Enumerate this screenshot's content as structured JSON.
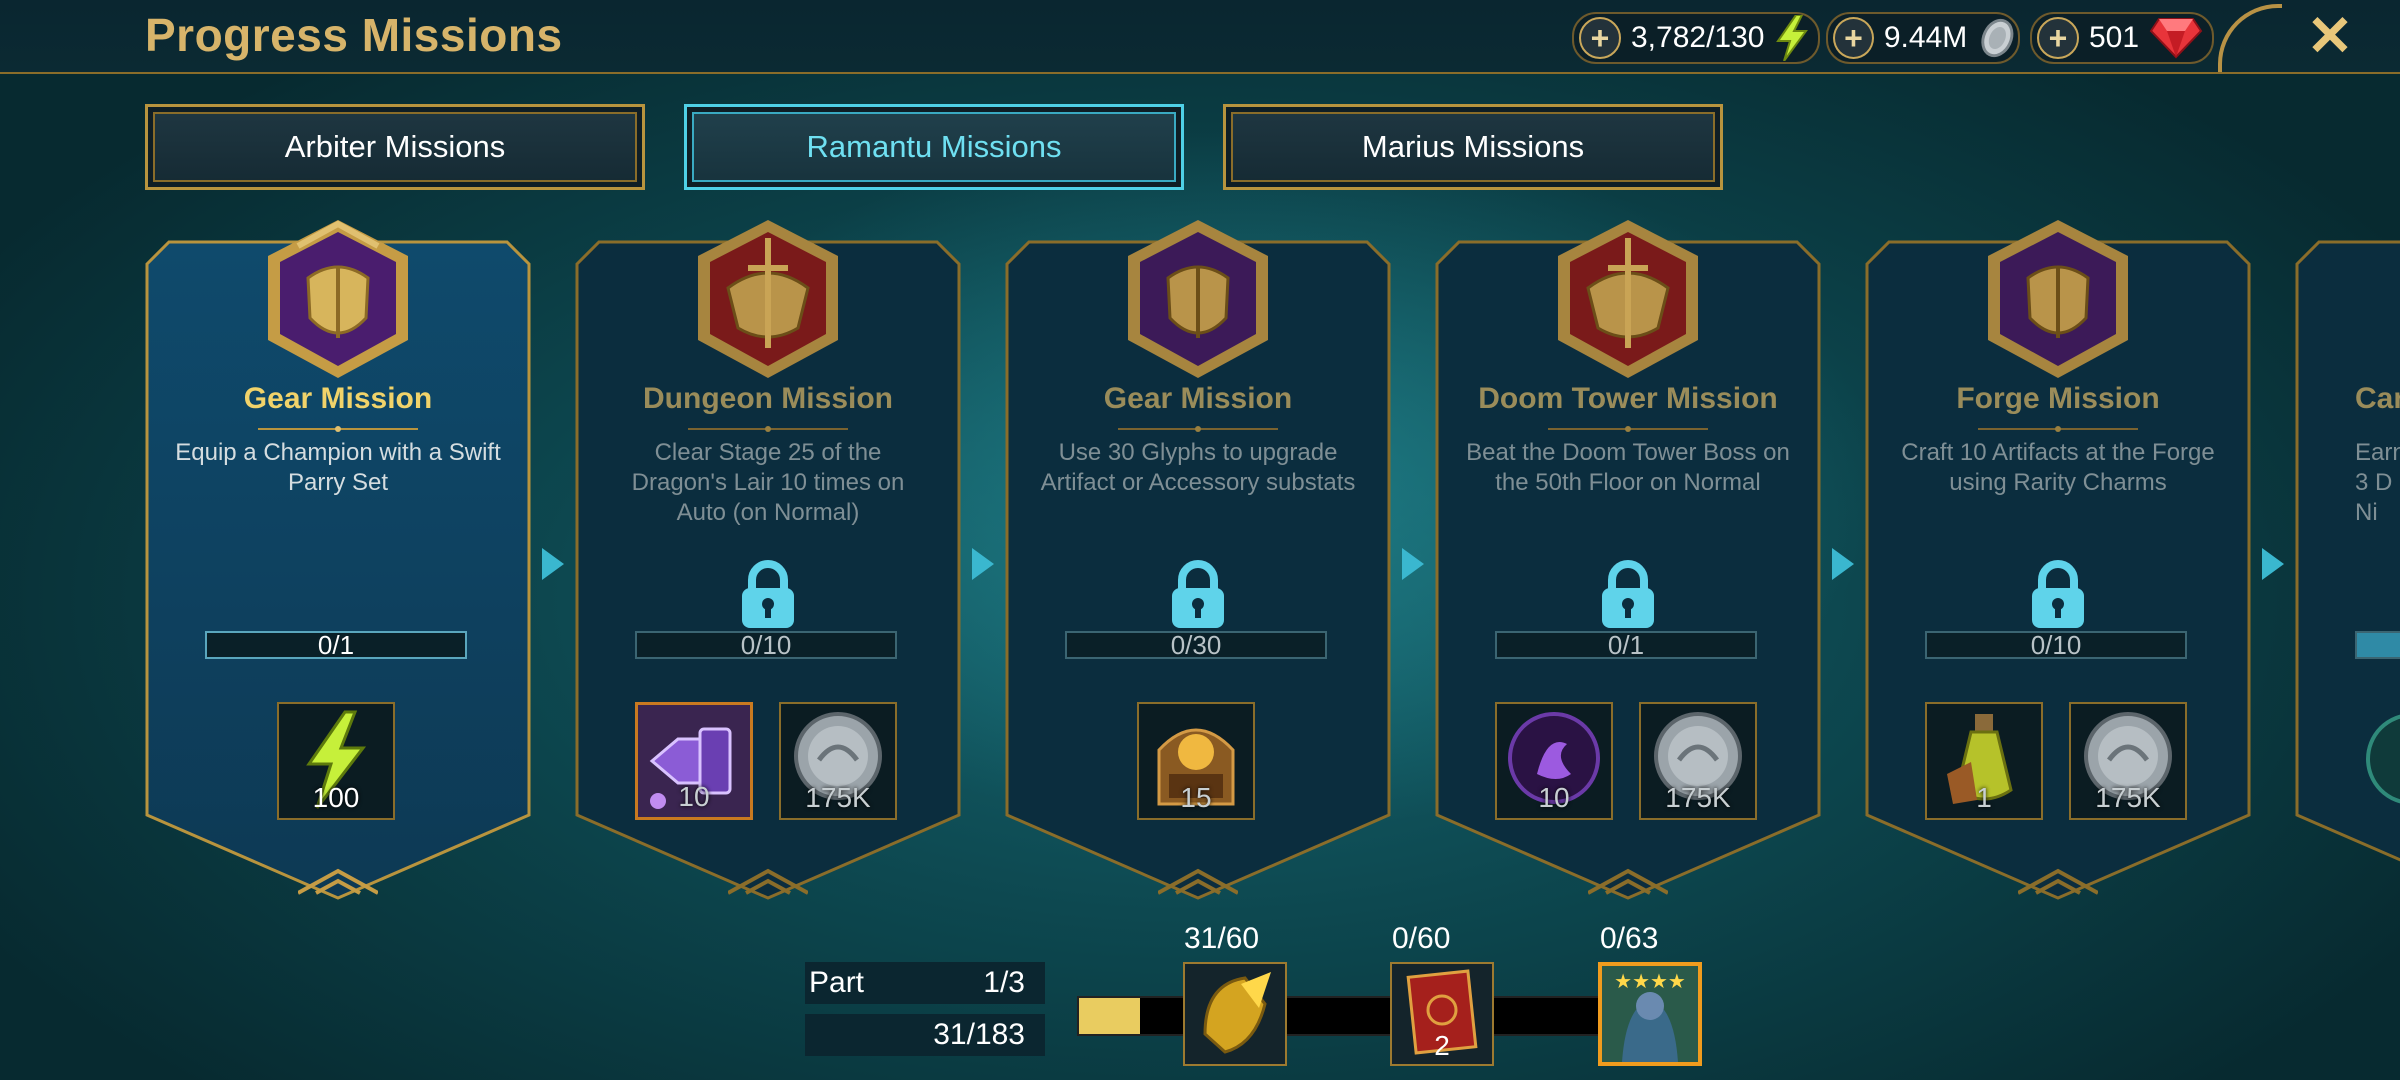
{
  "header": {
    "title": "Progress Missions",
    "resources": [
      {
        "value": "3,782/130",
        "icon": "energy-icon"
      },
      {
        "value": "9.44M",
        "icon": "silver-coin-icon"
      },
      {
        "value": "501",
        "icon": "gem-icon"
      }
    ],
    "close_icon": "close-icon"
  },
  "tabs": [
    {
      "label": "Arbiter Missions",
      "active": false
    },
    {
      "label": "Ramantu Missions",
      "active": true
    },
    {
      "label": "Marius Missions",
      "active": false
    }
  ],
  "missions": [
    {
      "title": "Gear Mission",
      "description": "Equip a Champion with a Swift Parry Set",
      "progress": "0/1",
      "progress_fraction": 0,
      "locked": false,
      "rewards": [
        {
          "icon": "energy-icon",
          "amount": "100"
        }
      ]
    },
    {
      "title": "Dungeon Mission",
      "description": "Clear Stage 25 of the Dragon's Lair 10 times on Auto (on Normal)",
      "progress": "0/10",
      "progress_fraction": 0,
      "locked": true,
      "rewards": [
        {
          "icon": "artifact-shard-icon",
          "amount": "10"
        },
        {
          "icon": "silver-coin-icon",
          "amount": "175K"
        }
      ]
    },
    {
      "title": "Gear Mission",
      "description": "Use 30 Glyphs to upgrade Artifact or Accessory substats",
      "progress": "0/30",
      "progress_fraction": 0,
      "locked": true,
      "rewards": [
        {
          "icon": "forge-shrine-icon",
          "amount": "15"
        }
      ]
    },
    {
      "title": "Doom Tower Mission",
      "description": "Beat the Doom Tower Boss on the 50th Floor on Normal",
      "progress": "0/1",
      "progress_fraction": 0,
      "locked": true,
      "rewards": [
        {
          "icon": "void-orb-icon",
          "amount": "10"
        },
        {
          "icon": "silver-coin-icon",
          "amount": "175K"
        }
      ]
    },
    {
      "title": "Forge Mission",
      "description": "Craft 10 Artifacts at the Forge using Rarity Charms",
      "progress": "0/10",
      "progress_fraction": 0,
      "locked": true,
      "rewards": [
        {
          "icon": "potion-icon",
          "amount": "1"
        },
        {
          "icon": "silver-coin-icon",
          "amount": "175K"
        }
      ]
    },
    {
      "title": "Car",
      "description": "Earn 3 D Ni",
      "progress": "",
      "progress_fraction": 0.2,
      "locked": false,
      "rewards": []
    }
  ],
  "part": {
    "label": "Part",
    "value": "1/3",
    "total": "31/183",
    "fraction": 0.11
  },
  "milestones": [
    {
      "count": "31/60",
      "icon": "champion-helmet-icon",
      "amount": ""
    },
    {
      "count": "0/60",
      "icon": "tome-icon",
      "amount": "2"
    },
    {
      "count": "0/63",
      "icon": "champion-portrait-icon",
      "amount": ""
    }
  ],
  "colors": {
    "gold": "#d7b46a",
    "cyan": "#4fd0e6",
    "energy": "#c6f03a",
    "gem": "#e8343a"
  }
}
